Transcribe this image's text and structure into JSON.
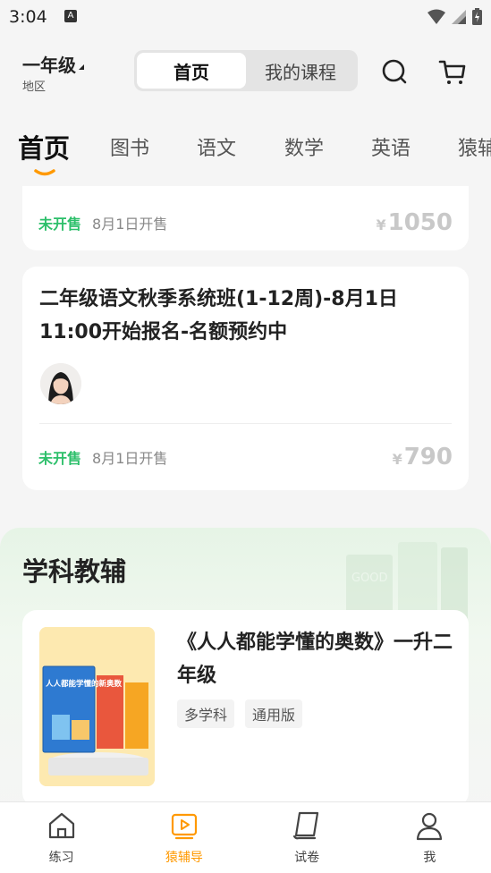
{
  "status_bar": {
    "time": "3:04",
    "notif_letter": "A"
  },
  "header": {
    "grade": "一年级",
    "region": "地区",
    "tabs": [
      {
        "label": "首页",
        "active": true
      },
      {
        "label": "我的课程",
        "active": false
      }
    ],
    "icons": [
      "search-icon",
      "cart-icon"
    ]
  },
  "categories": [
    {
      "label": "首页",
      "active": true
    },
    {
      "label": "图书"
    },
    {
      "label": "语文"
    },
    {
      "label": "数学"
    },
    {
      "label": "英语"
    },
    {
      "label": "猿辅"
    }
  ],
  "courses": [
    {
      "status": "未开售",
      "sale_date": "8月1日开售",
      "currency": "¥",
      "price": "1050"
    },
    {
      "title": "二年级语文秋季系统班(1-12周)-8月1日11:00开始报名-名额预约中",
      "status": "未开售",
      "sale_date": "8月1日开售",
      "currency": "¥",
      "price": "790"
    }
  ],
  "section": {
    "title": "学科教辅",
    "deco_text": "GOOD",
    "book": {
      "cover_text": "人人都能学懂的新奥数",
      "title": "《人人都能学懂的奥数》一升二年级",
      "tags": [
        "多学科",
        "通用版"
      ]
    }
  },
  "bottom_nav": [
    {
      "label": "练习",
      "icon": "house-icon",
      "active": false
    },
    {
      "label": "猿辅导",
      "icon": "play-icon",
      "active": true
    },
    {
      "label": "试卷",
      "icon": "scroll-icon",
      "active": false
    },
    {
      "label": "我",
      "icon": "person-icon",
      "active": false
    }
  ],
  "colors": {
    "accent": "#ff9900",
    "status_green": "#2cbf6a",
    "price_gray": "#c8c8c8"
  }
}
